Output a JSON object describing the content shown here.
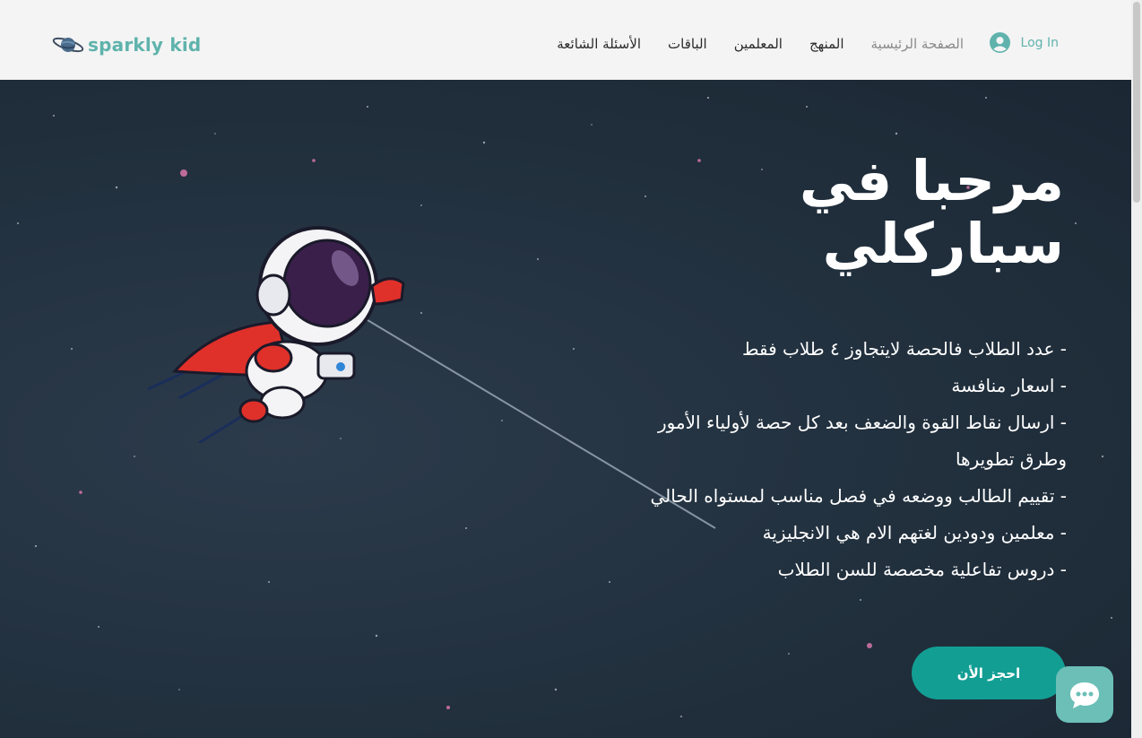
{
  "brand": {
    "name": "sparkly kid",
    "icon": "planet-icon"
  },
  "nav": [
    {
      "label": "الصفحة الرئيسية",
      "active": true
    },
    {
      "label": "المنهج",
      "active": false
    },
    {
      "label": "المعلمين",
      "active": false
    },
    {
      "label": "الباقات",
      "active": false
    },
    {
      "label": "الأسئلة الشائعة",
      "active": false
    }
  ],
  "login": {
    "label": "Log In",
    "icon": "user-avatar-icon"
  },
  "hero": {
    "title_line1": "مرحبا في",
    "title_line2": "سباركلي",
    "features": [
      "- عدد الطلاب فالحصة لايتجاوز ٤ طلاب فقط",
      "- اسعار منافسة",
      "- ارسال نقاط القوة والضعف بعد كل حصة لأولياء الأمور وطرق تطويرها",
      "- تقييم الطالب ووضعه في فصل مناسب لمستواه الحالي",
      "- معلمين ودودين لغتهم الام هي الانجليزية",
      "- دروس تفاعلية مخصصة للسن الطلاب"
    ],
    "cta_label": "احجز الأن",
    "illustration": "astronaut-icon"
  },
  "chat": {
    "icon": "chat-bubble-icon"
  },
  "colors": {
    "accent": "#139e94",
    "brand": "#5fb3ac",
    "header_bg": "#f4f4f4",
    "hero_bg": "#1e2a36"
  }
}
